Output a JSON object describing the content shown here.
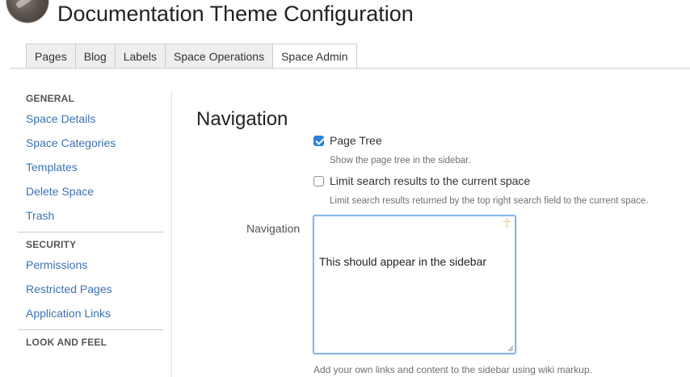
{
  "header": {
    "title": "Documentation Theme Configuration"
  },
  "tabs": [
    {
      "label": "Pages"
    },
    {
      "label": "Blog"
    },
    {
      "label": "Labels"
    },
    {
      "label": "Space Operations"
    },
    {
      "label": "Space Admin",
      "active": true
    }
  ],
  "sidebar": {
    "sections": [
      {
        "heading": "GENERAL",
        "items": [
          "Space Details",
          "Space Categories",
          "Templates",
          "Delete Space",
          "Trash"
        ]
      },
      {
        "heading": "SECURITY",
        "items": [
          "Permissions",
          "Restricted Pages",
          "Application Links"
        ]
      },
      {
        "heading": "LOOK AND FEEL",
        "items": []
      }
    ]
  },
  "main": {
    "heading": "Navigation",
    "page_tree": {
      "label": "Page Tree",
      "checked": true,
      "hint": "Show the page tree in the sidebar."
    },
    "limit_search": {
      "label": "Limit search results to the current space",
      "checked": false,
      "hint": "Limit search results returned by the top right search field to the current space."
    },
    "navigation_field": {
      "label": "Navigation",
      "value": "This should appear in the sidebar",
      "hint": "Add your own links and content to the sidebar using wiki markup."
    }
  },
  "colors": {
    "link": "#3b73af",
    "checkbox_checked": "#2e7fd9",
    "focus_border": "#8ab6e8"
  }
}
